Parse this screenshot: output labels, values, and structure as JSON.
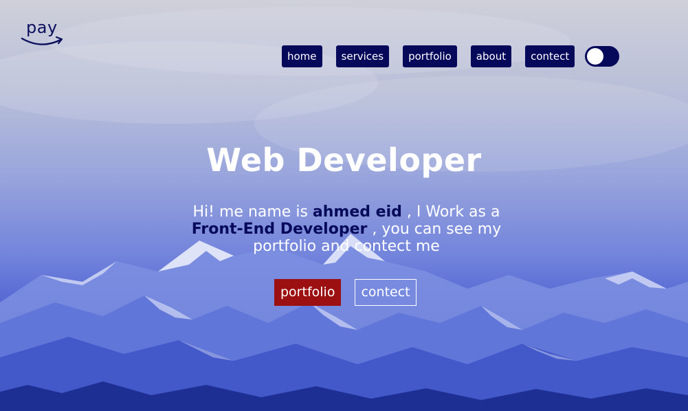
{
  "brand": {
    "logo_text": "pay"
  },
  "nav": {
    "items": [
      {
        "label": "home"
      },
      {
        "label": "services"
      },
      {
        "label": "portfolio"
      },
      {
        "label": "about"
      },
      {
        "label": "contect"
      }
    ],
    "theme_toggle": {
      "state": "off"
    }
  },
  "hero": {
    "title": "Web Developer",
    "intro": {
      "part1": "Hi! me name is ",
      "name": "ahmed eid",
      "part2": " , I Work as a ",
      "role": "Front-End Developer",
      "part3": " , you can see my portfolio and contect me"
    },
    "buttons": {
      "primary_label": "portfolio",
      "secondary_label": "contect"
    }
  },
  "colors": {
    "nav_bg": "#06085a",
    "primary_button": "#9c1012",
    "highlight_text": "#070a5a",
    "overlay": "#3848c8"
  }
}
